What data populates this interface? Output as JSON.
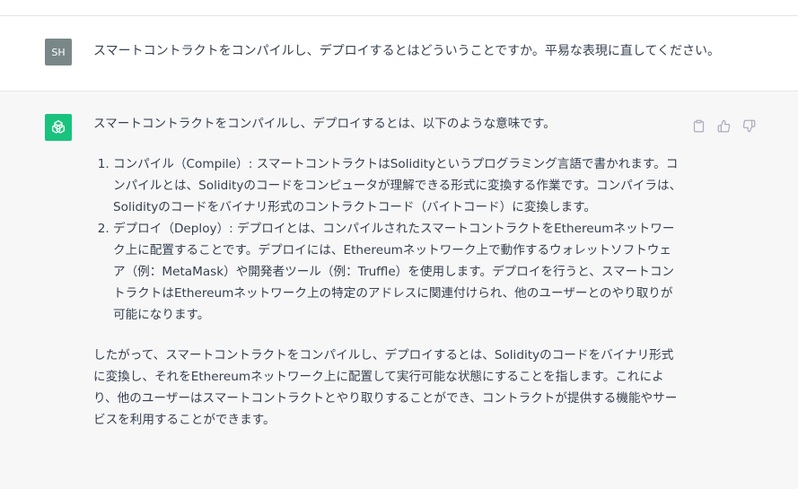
{
  "user_message": {
    "avatar": "SH",
    "text": "スマートコントラクトをコンパイルし、デプロイするとはどういうことですか。平易な表現に直してください。"
  },
  "assistant_message": {
    "intro": "スマートコントラクトをコンパイルし、デプロイするとは、以下のような意味です。",
    "points": [
      "コンパイル（Compile）: スマートコントラクトはSolidityというプログラミング言語で書かれます。コンパイルとは、Solidityのコードをコンピュータが理解できる形式に変換する作業です。コンパイラは、Solidityのコードをバイナリ形式のコントラクトコード（バイトコード）に変換します。",
      "デプロイ（Deploy）: デプロイとは、コンパイルされたスマートコントラクトをEthereumネットワーク上に配置することです。デプロイには、Ethereumネットワーク上で動作するウォレットソフトウェア（例：MetaMask）や開発者ツール（例：Truffle）を使用します。デプロイを行うと、スマートコントラクトはEthereumネットワーク上の特定のアドレスに関連付けられ、他のユーザーとのやり取りが可能になります。"
    ],
    "conclusion": "したがって、スマートコントラクトをコンパイルし、デプロイするとは、Solidityのコードをバイナリ形式に変換し、それをEthereumネットワーク上に配置して実行可能な状態にすることを指します。これにより、他のユーザーはスマートコントラクトとやり取りすることができ、コントラクトが提供する機能やサービスを利用することができます。"
  },
  "actions": [
    "clipboard-icon",
    "thumbs-up-icon",
    "thumbs-down-icon"
  ],
  "colors": {
    "assistant_bg": "#f7f7f8",
    "bot_avatar": "#19c37d",
    "user_avatar": "#7a8788"
  }
}
